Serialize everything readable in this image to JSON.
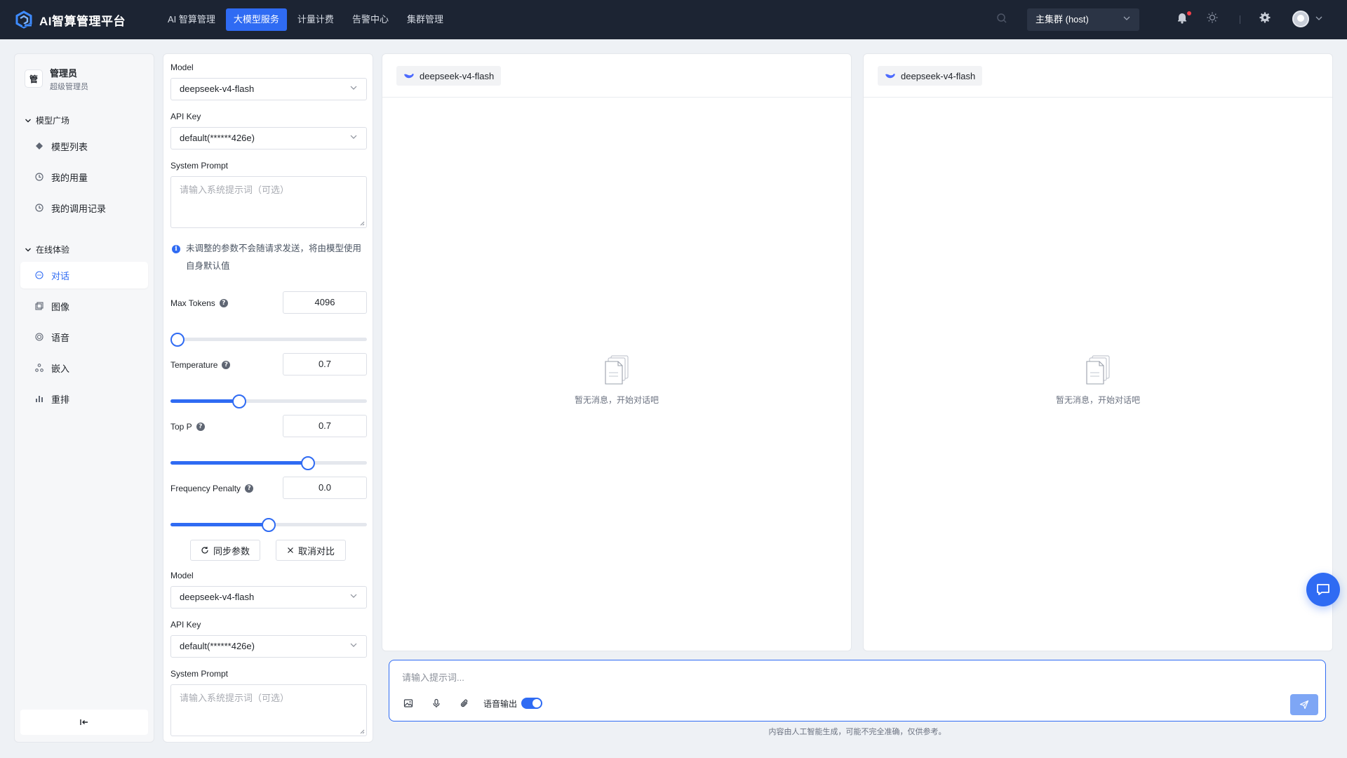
{
  "app": {
    "title": "AI智算管理平台"
  },
  "topnav": {
    "items": [
      "AI 智算管理",
      "大模型服务",
      "计量计费",
      "告警中心",
      "集群管理"
    ],
    "active_index": 1
  },
  "header": {
    "cluster": "主集群 (host)"
  },
  "user": {
    "badge": "管",
    "name": "管理员",
    "role": "超级管理员"
  },
  "sidebar": {
    "group1": {
      "title": "模型广场",
      "items": [
        {
          "label": "模型列表",
          "icon": "model-icon"
        },
        {
          "label": "我的用量",
          "icon": "usage-icon"
        },
        {
          "label": "我的调用记录",
          "icon": "history-icon"
        }
      ]
    },
    "group2": {
      "title": "在线体验",
      "items": [
        {
          "label": "对话",
          "icon": "chat-icon",
          "active": true
        },
        {
          "label": "图像",
          "icon": "image-icon"
        },
        {
          "label": "语音",
          "icon": "audio-icon"
        },
        {
          "label": "嵌入",
          "icon": "embed-icon"
        },
        {
          "label": "重排",
          "icon": "rerank-icon"
        }
      ]
    }
  },
  "params": {
    "model_label": "Model",
    "model_value": "deepseek-v4-flash",
    "apikey_label": "API Key",
    "apikey_value": "default(******426e)",
    "system_prompt_label": "System Prompt",
    "system_prompt_placeholder": "请输入系统提示词（可选）",
    "info_text": "未调整的参数不会随请求发送，将由模型使用自身默认值",
    "max_tokens": {
      "label": "Max Tokens",
      "value": "4096",
      "slider": 0.0
    },
    "temperature": {
      "label": "Temperature",
      "value": "0.7",
      "slider": 0.35
    },
    "top_p": {
      "label": "Top P",
      "value": "0.7",
      "slider": 0.7
    },
    "frequency_penalty": {
      "label": "Frequency Penalty",
      "value": "0.0",
      "slider": 0.5
    },
    "sync_button": "同步参数",
    "cancel_button": "取消对比",
    "model2_label": "Model",
    "model2_value": "deepseek-v4-flash",
    "apikey2_label": "API Key",
    "apikey2_value": "default(******426e)",
    "system_prompt2_label": "System Prompt",
    "system_prompt2_placeholder": "请输入系统提示词（可选）"
  },
  "panes": [
    {
      "model": "deepseek-v4-flash",
      "empty": "暂无消息，开始对话吧"
    },
    {
      "model": "deepseek-v4-flash",
      "empty": "暂无消息，开始对话吧"
    }
  ],
  "composer": {
    "placeholder": "请输入提示词...",
    "voice_label": "语音输出",
    "voice_on": true,
    "disclaimer": "内容由人工智能生成，可能不完全准确，仅供参考。"
  },
  "colors": {
    "accent": "#2f6bf3",
    "header_bg": "#1c2433",
    "page_bg": "#eef1f5"
  }
}
